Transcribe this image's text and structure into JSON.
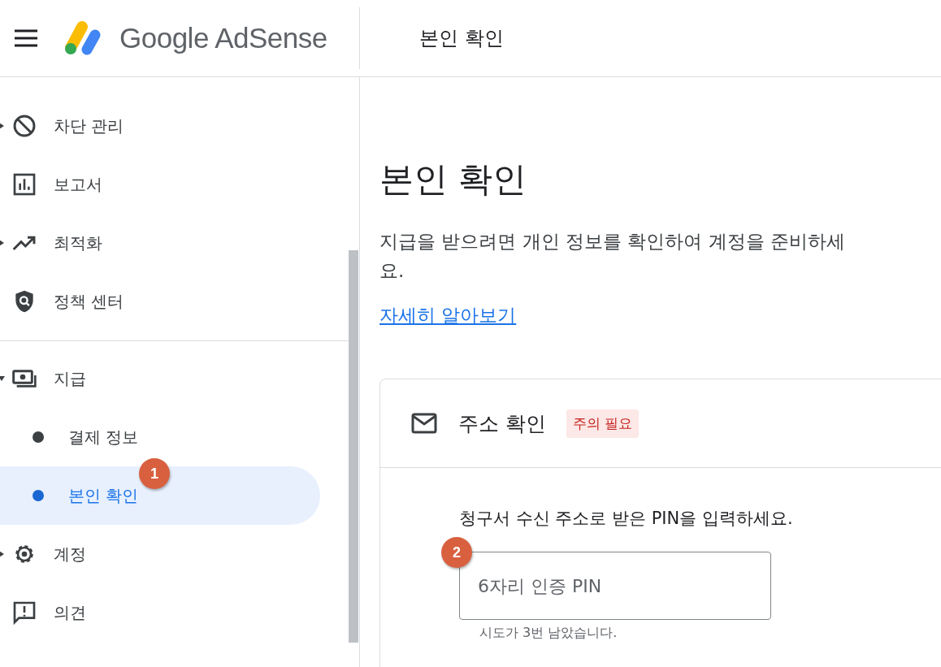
{
  "header": {
    "logo_text": "Google AdSense",
    "page_title": "본인 확인"
  },
  "sidebar": {
    "groups": [
      [
        {
          "label": "차단 관리",
          "expandable": true,
          "expanded": false
        },
        {
          "label": "보고서",
          "expandable": false
        },
        {
          "label": "최적화",
          "expandable": true,
          "expanded": false
        },
        {
          "label": "정책 센터",
          "expandable": false
        }
      ],
      [
        {
          "label": "지급",
          "expandable": true,
          "expanded": true,
          "children": [
            {
              "label": "결제 정보",
              "selected": false
            },
            {
              "label": "본인 확인",
              "selected": true,
              "marker": "1"
            }
          ]
        },
        {
          "label": "계정",
          "expandable": true,
          "expanded": false
        },
        {
          "label": "의견",
          "expandable": false
        }
      ]
    ]
  },
  "main": {
    "title": "본인 확인",
    "description": "지급을 받으려면 개인 정보를 확인하여 계정을 준비하세요.",
    "link": "자세히 알아보기",
    "card": {
      "title": "주소 확인",
      "badge": "주의 필요",
      "instruction": "청구서 수신 주소로 받은 PIN을 입력하세요.",
      "marker": "2",
      "pin_field": {
        "placeholder": "6자리 인증 PIN"
      },
      "helper": "시도가 3번 남았습니다."
    }
  }
}
